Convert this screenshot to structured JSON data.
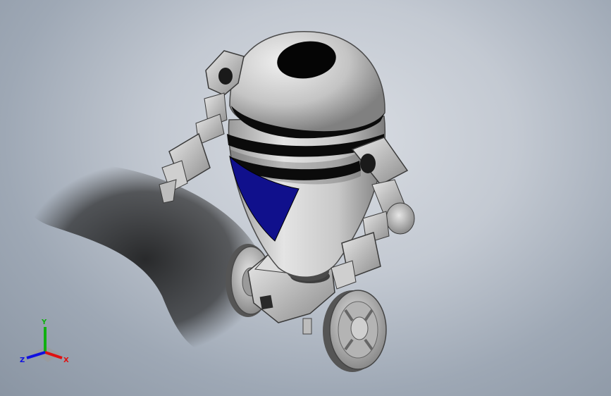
{
  "viewport": {
    "background_top": "#c3c9d2",
    "background_bottom": "#8a95a3"
  },
  "model": {
    "body_color": "#c8c8c8",
    "stripe_color": "#0b0b0b",
    "accent_color": "#10108c",
    "shadow_color": "#1b1b1b"
  },
  "triad": {
    "x_label": "X",
    "y_label": "Y",
    "z_label": "Z",
    "x_color": "#e01010",
    "y_color": "#10b010",
    "z_color": "#1010e0"
  }
}
